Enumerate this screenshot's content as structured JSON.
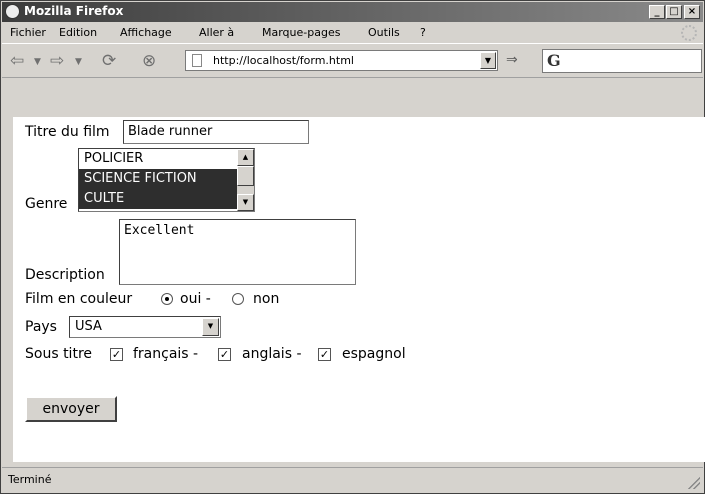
{
  "window": {
    "title": "Mozilla Firefox"
  },
  "controls": {
    "minimize": "_",
    "maximize": "□",
    "close": "×"
  },
  "menu": {
    "items": [
      "Fichier",
      "Edition",
      "Affichage",
      "Aller à",
      "Marque-pages",
      "Outils",
      "?"
    ]
  },
  "toolbar": {
    "back_icon": "back-arrow-icon",
    "forward_icon": "forward-arrow-icon",
    "reload_icon": "reload-icon",
    "stop_icon": "stop-icon",
    "url": "http://localhost/form.html",
    "search_engine": "G"
  },
  "form": {
    "title_label": "Titre du film",
    "title_value": "Blade runner",
    "genre_label": "Genre",
    "genre_options": [
      "POLICIER",
      "SCIENCE FICTION",
      "CULTE"
    ],
    "genre_selected": [
      "SCIENCE FICTION",
      "CULTE"
    ],
    "description_label": "Description",
    "description_value": "Excellent",
    "color_label": "Film en couleur",
    "color_oui": "oui -",
    "color_non": "non",
    "color_selected": "oui",
    "country_label": "Pays",
    "country_value": "USA",
    "subtitle_label": "Sous titre",
    "subtitle_fr": "français -",
    "subtitle_en": "anglais -",
    "subtitle_es": "espagnol",
    "subtitles_checked": [
      "français",
      "anglais",
      "espagnol"
    ],
    "submit_label": "envoyer"
  },
  "status": {
    "text": "Terminé"
  },
  "colors": {
    "selection": "#2e2e2e",
    "chrome": "#d6d3ce"
  }
}
